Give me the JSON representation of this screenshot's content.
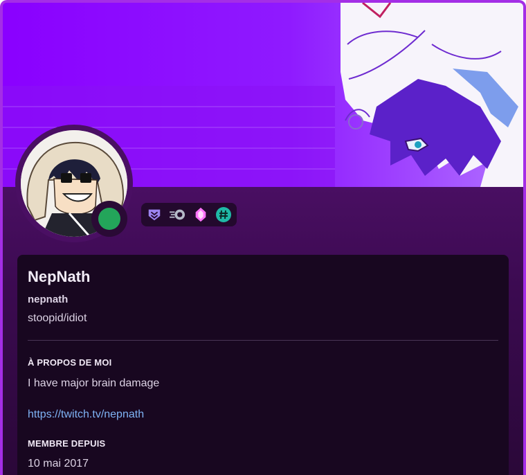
{
  "profile": {
    "display_name": "NepNath",
    "username": "nepnath",
    "pronouns": "stoopid/idiot",
    "status": "online",
    "status_color": "#23a55a",
    "banner_color": "#8a00ff",
    "accent_border": "#a42ee6"
  },
  "badges": [
    {
      "name": "hypesquad-bravery-icon"
    },
    {
      "name": "nitro-icon"
    },
    {
      "name": "boost-gem-icon"
    },
    {
      "name": "hashtag-icon"
    }
  ],
  "about": {
    "title": "À PROPOS DE MOI",
    "text": "I have major brain damage",
    "link": "https://twitch.tv/nepnath"
  },
  "member_since": {
    "title": "MEMBRE DEPUIS",
    "date": "10 mai 2017"
  }
}
